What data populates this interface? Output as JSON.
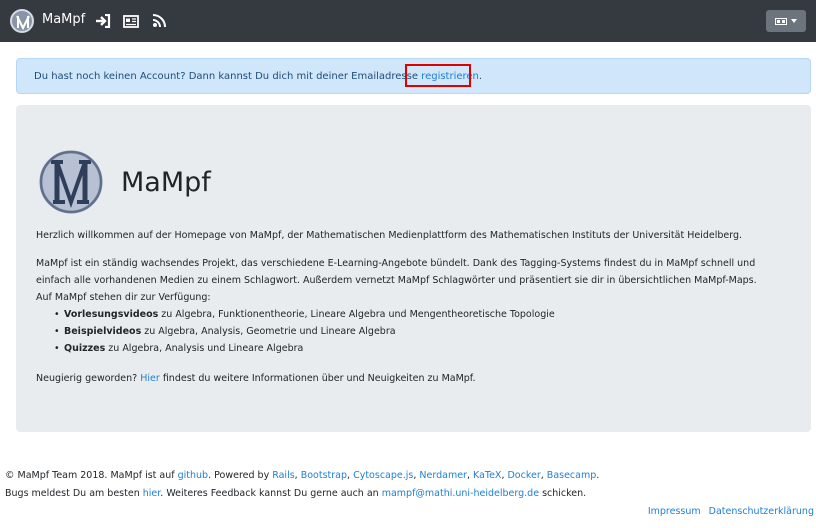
{
  "navbar": {
    "brand": "MaMpf",
    "icons": [
      "sign-in-icon",
      "news-icon",
      "rss-icon"
    ],
    "language_icon": "flag-icon"
  },
  "alert": {
    "text": "Du hast noch keinen Account? Dann kannst Du dich mit deiner Emailadresse ",
    "link": "registrieren",
    "end": "."
  },
  "hero": {
    "title": "MaMpf",
    "welcome": "Herzlich willkommen auf der Homepage von MaMpf, der Mathematischen Medienplattform des Mathematischen Instituts der Universität Heidelberg.",
    "desc1": "MaMpf ist ein ständig wachsendes Projekt, das verschiedene E-Learning-Angebote bündelt. Dank des Tagging-Systems findest du in MaMpf schnell und",
    "desc2": "einfach alle vorhandenen Medien zu einem Schlagwort. Außerdem vernetzt MaMpf Schlagwörter und präsentiert sie dir in übersichtlichen MaMpf-Maps.",
    "desc3": "Auf MaMpf stehen dir zur Verfügung:",
    "bullets": [
      {
        "bold": "Vorlesungsvideos",
        "rest": " zu Algebra, Funktionentheorie, Lineare Algebra und Mengentheoretische Topologie"
      },
      {
        "bold": "Beispielvideos",
        "rest": " zu Algebra, Analysis, Geometrie und Lineare Algebra"
      },
      {
        "bold": "Quizzes",
        "rest": " zu Algebra, Analysis und Lineare Algebra"
      }
    ],
    "curious_pre": "Neugierig geworden? ",
    "curious_link": "Hier",
    "curious_post": " findest du weitere Informationen über und Neuigkeiten zu MaMpf."
  },
  "footer": {
    "line1_pre": "© MaMpf Team 2018. MaMpf ist auf ",
    "github": "github",
    "line1_mid": ". Powered by ",
    "powered": [
      "Rails",
      "Bootstrap",
      "Cytoscape.js",
      "Nerdamer",
      "KaTeX",
      "Docker",
      "Basecamp"
    ],
    "line1_end": ".",
    "line2_pre": "Bugs meldest Du am besten ",
    "here": "hier",
    "line2_mid": ". Weiteres Feedback kannst Du gerne auch an ",
    "email": "mampf@mathi.uni-heidelberg.de",
    "line2_end": " schicken.",
    "impressum": "Impressum",
    "privacy": "Datenschutzerklärung"
  },
  "colors": {
    "navbar": "#343a40",
    "alert_bg": "#cfe6fb",
    "jumbotron_bg": "#e9ecef",
    "link": "#1e7fd6",
    "highlight": "#e00000"
  }
}
